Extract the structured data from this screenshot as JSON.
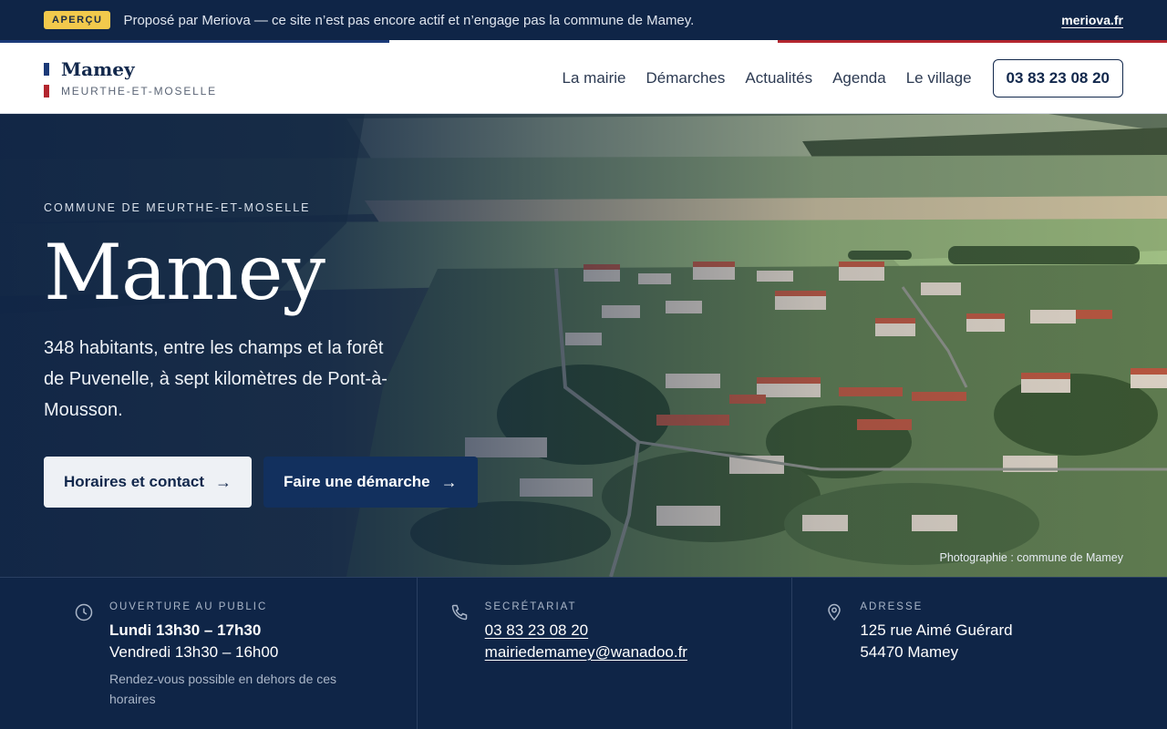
{
  "preview": {
    "badge": "APERÇU",
    "text": "Proposé par Meriova — ce site n’est pas encore actif et n’engage pas la commune de Mamey.",
    "link": "meriova.fr"
  },
  "colors": {
    "navy": "#0f2547",
    "accent_blue": "#12305e",
    "flag_blue": "#1b3a78",
    "flag_red": "#b3262f",
    "badge_yellow": "#f2c94c"
  },
  "header": {
    "brand_name": "Mamey",
    "brand_sub": "MEURTHE-ET-MOSELLE",
    "nav": [
      "La mairie",
      "Démarches",
      "Actualités",
      "Agenda",
      "Le village"
    ],
    "phone": "03 83 23 08 20"
  },
  "hero": {
    "eyebrow": "COMMUNE DE MEURTHE-ET-MOSELLE",
    "title": "Mamey",
    "description": "348 habitants, entre les champs et la forêt de Puvenelle, à sept kilomètres de Pont-à-Mousson.",
    "primary_button": "Horaires et contact",
    "secondary_button": "Faire une démarche",
    "button_icon": "arrow-right-icon",
    "photo_credit": "Photographie : commune de Mamey"
  },
  "info": {
    "hours": {
      "icon": "clock-icon",
      "label": "OUVERTURE AU PUBLIC",
      "line1": "Lundi 13h30 – 17h30",
      "line2": "Vendredi 13h30 – 16h00",
      "note": "Rendez-vous possible en dehors de ces horaires"
    },
    "secretariat": {
      "icon": "phone-icon",
      "label": "SECRÉTARIAT",
      "phone": "03 83 23 08 20",
      "email": "mairiedemamey@wanadoo.fr"
    },
    "address": {
      "icon": "location-pin-icon",
      "label": "ADRESSE",
      "line1": "125 rue Aimé Guérard",
      "line2": "54470 Mamey"
    }
  }
}
